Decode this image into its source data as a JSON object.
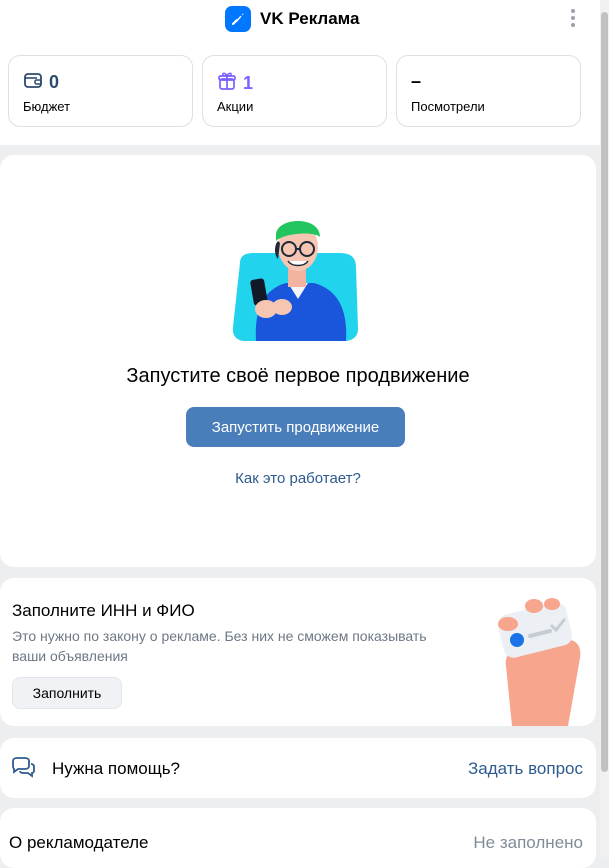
{
  "header": {
    "title": "VK Реклама",
    "logo_icon": "vk-ads-rocket-icon",
    "menu_icon": "more-vertical-icon"
  },
  "stats": [
    {
      "icon": "wallet-icon",
      "value": "0",
      "label": "Бюджет",
      "color": "#2c4b6e"
    },
    {
      "icon": "gift-icon",
      "value": "1",
      "label": "Акции",
      "color": "#7b61ff"
    },
    {
      "icon": "",
      "value": "–",
      "label": "Посмотрели",
      "color": "#000000"
    }
  ],
  "promo": {
    "title": "Запустите своё первое продвижение",
    "button": "Запустить продвижение",
    "link": "Как это работает?"
  },
  "inn": {
    "title": "Заполните ИНН и ФИО",
    "description": "Это нужно по закону о рекламе. Без них не сможем показывать ваши объявления",
    "button": "Заполнить"
  },
  "help": {
    "icon": "chat-bubbles-icon",
    "label": "Нужна помощь?",
    "link": "Задать вопрос"
  },
  "advertiser": {
    "label": "О рекламодателе",
    "status": "Не заполнено"
  },
  "colors": {
    "accent": "#4a7ebb",
    "link": "#2d5b8e",
    "brand": "#0077ff"
  }
}
